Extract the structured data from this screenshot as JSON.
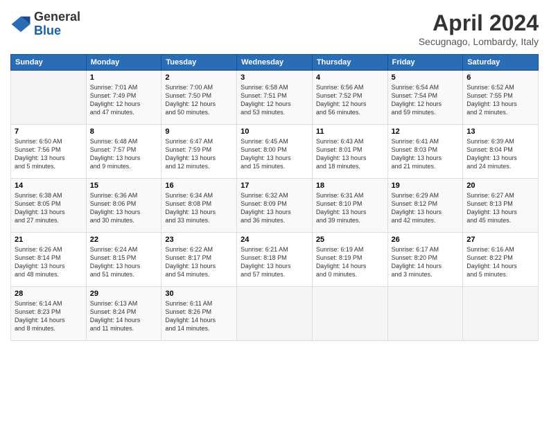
{
  "header": {
    "logo": {
      "line1": "General",
      "line2": "Blue"
    },
    "title": "April 2024",
    "subtitle": "Secugnago, Lombardy, Italy"
  },
  "calendar": {
    "days": [
      "Sunday",
      "Monday",
      "Tuesday",
      "Wednesday",
      "Thursday",
      "Friday",
      "Saturday"
    ],
    "weeks": [
      [
        {
          "num": "",
          "info": ""
        },
        {
          "num": "1",
          "info": "Sunrise: 7:01 AM\nSunset: 7:49 PM\nDaylight: 12 hours\nand 47 minutes."
        },
        {
          "num": "2",
          "info": "Sunrise: 7:00 AM\nSunset: 7:50 PM\nDaylight: 12 hours\nand 50 minutes."
        },
        {
          "num": "3",
          "info": "Sunrise: 6:58 AM\nSunset: 7:51 PM\nDaylight: 12 hours\nand 53 minutes."
        },
        {
          "num": "4",
          "info": "Sunrise: 6:56 AM\nSunset: 7:52 PM\nDaylight: 12 hours\nand 56 minutes."
        },
        {
          "num": "5",
          "info": "Sunrise: 6:54 AM\nSunset: 7:54 PM\nDaylight: 12 hours\nand 59 minutes."
        },
        {
          "num": "6",
          "info": "Sunrise: 6:52 AM\nSunset: 7:55 PM\nDaylight: 13 hours\nand 2 minutes."
        }
      ],
      [
        {
          "num": "7",
          "info": "Sunrise: 6:50 AM\nSunset: 7:56 PM\nDaylight: 13 hours\nand 5 minutes."
        },
        {
          "num": "8",
          "info": "Sunrise: 6:48 AM\nSunset: 7:57 PM\nDaylight: 13 hours\nand 9 minutes."
        },
        {
          "num": "9",
          "info": "Sunrise: 6:47 AM\nSunset: 7:59 PM\nDaylight: 13 hours\nand 12 minutes."
        },
        {
          "num": "10",
          "info": "Sunrise: 6:45 AM\nSunset: 8:00 PM\nDaylight: 13 hours\nand 15 minutes."
        },
        {
          "num": "11",
          "info": "Sunrise: 6:43 AM\nSunset: 8:01 PM\nDaylight: 13 hours\nand 18 minutes."
        },
        {
          "num": "12",
          "info": "Sunrise: 6:41 AM\nSunset: 8:03 PM\nDaylight: 13 hours\nand 21 minutes."
        },
        {
          "num": "13",
          "info": "Sunrise: 6:39 AM\nSunset: 8:04 PM\nDaylight: 13 hours\nand 24 minutes."
        }
      ],
      [
        {
          "num": "14",
          "info": "Sunrise: 6:38 AM\nSunset: 8:05 PM\nDaylight: 13 hours\nand 27 minutes."
        },
        {
          "num": "15",
          "info": "Sunrise: 6:36 AM\nSunset: 8:06 PM\nDaylight: 13 hours\nand 30 minutes."
        },
        {
          "num": "16",
          "info": "Sunrise: 6:34 AM\nSunset: 8:08 PM\nDaylight: 13 hours\nand 33 minutes."
        },
        {
          "num": "17",
          "info": "Sunrise: 6:32 AM\nSunset: 8:09 PM\nDaylight: 13 hours\nand 36 minutes."
        },
        {
          "num": "18",
          "info": "Sunrise: 6:31 AM\nSunset: 8:10 PM\nDaylight: 13 hours\nand 39 minutes."
        },
        {
          "num": "19",
          "info": "Sunrise: 6:29 AM\nSunset: 8:12 PM\nDaylight: 13 hours\nand 42 minutes."
        },
        {
          "num": "20",
          "info": "Sunrise: 6:27 AM\nSunset: 8:13 PM\nDaylight: 13 hours\nand 45 minutes."
        }
      ],
      [
        {
          "num": "21",
          "info": "Sunrise: 6:26 AM\nSunset: 8:14 PM\nDaylight: 13 hours\nand 48 minutes."
        },
        {
          "num": "22",
          "info": "Sunrise: 6:24 AM\nSunset: 8:15 PM\nDaylight: 13 hours\nand 51 minutes."
        },
        {
          "num": "23",
          "info": "Sunrise: 6:22 AM\nSunset: 8:17 PM\nDaylight: 13 hours\nand 54 minutes."
        },
        {
          "num": "24",
          "info": "Sunrise: 6:21 AM\nSunset: 8:18 PM\nDaylight: 13 hours\nand 57 minutes."
        },
        {
          "num": "25",
          "info": "Sunrise: 6:19 AM\nSunset: 8:19 PM\nDaylight: 14 hours\nand 0 minutes."
        },
        {
          "num": "26",
          "info": "Sunrise: 6:17 AM\nSunset: 8:20 PM\nDaylight: 14 hours\nand 3 minutes."
        },
        {
          "num": "27",
          "info": "Sunrise: 6:16 AM\nSunset: 8:22 PM\nDaylight: 14 hours\nand 5 minutes."
        }
      ],
      [
        {
          "num": "28",
          "info": "Sunrise: 6:14 AM\nSunset: 8:23 PM\nDaylight: 14 hours\nand 8 minutes."
        },
        {
          "num": "29",
          "info": "Sunrise: 6:13 AM\nSunset: 8:24 PM\nDaylight: 14 hours\nand 11 minutes."
        },
        {
          "num": "30",
          "info": "Sunrise: 6:11 AM\nSunset: 8:26 PM\nDaylight: 14 hours\nand 14 minutes."
        },
        {
          "num": "",
          "info": ""
        },
        {
          "num": "",
          "info": ""
        },
        {
          "num": "",
          "info": ""
        },
        {
          "num": "",
          "info": ""
        }
      ]
    ]
  }
}
